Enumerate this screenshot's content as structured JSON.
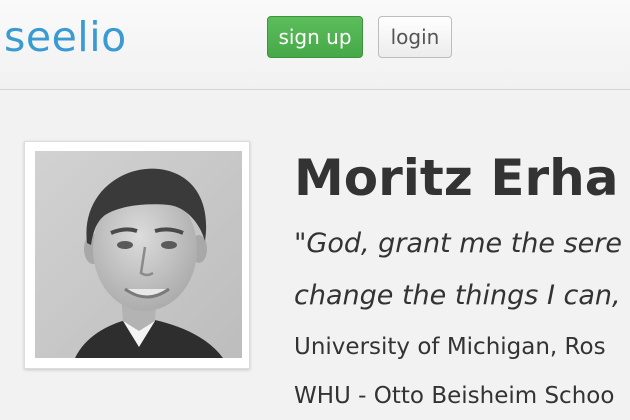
{
  "header": {
    "logo_text": "seelio",
    "signup_label": "sign up",
    "login_label": "login"
  },
  "profile": {
    "name": "Moritz Erha",
    "quote_line1": "\"God, grant me the sere",
    "quote_line2": "change the things I can,",
    "education": [
      "University of Michigan, Ros",
      "WHU - Otto Beisheim Schoo"
    ]
  },
  "colors": {
    "brand": "#3a9bd3",
    "signup_green": "#4cae4c",
    "text": "#333333",
    "background": "#f2f2f2"
  }
}
